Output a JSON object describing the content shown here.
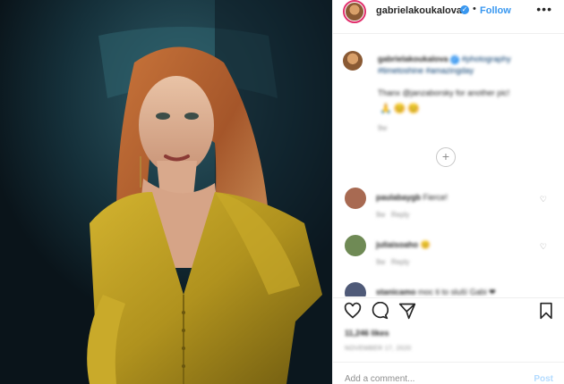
{
  "header": {
    "username": "gabrielakoukalova",
    "verified_mark": "✓",
    "separator": "•",
    "follow_label": "Follow",
    "more_label": "•••"
  },
  "caption": {
    "username": "gabrielakoukalova",
    "hashtags": "#photography #timetoshine #amazingday",
    "thanks": "Thanx @janzaborsky for another pic!",
    "emojis": "🙏😊😊",
    "age": "9w"
  },
  "load_more_label": "+",
  "comments": [
    {
      "username": "paulabaygb",
      "text": "Fierce!",
      "age": "9w",
      "reply": "Reply",
      "avatar_color": "#a86a52"
    },
    {
      "username": "juliaisoaho",
      "text": "😊",
      "age": "9w",
      "reply": "Reply",
      "avatar_color": "#6f8a55"
    },
    {
      "username": "stanicamo",
      "text": "moc ti to sluší Gabi ❤",
      "age": "",
      "reply": "",
      "avatar_color": "#4f5a78"
    }
  ],
  "actions": {
    "like_icon": "heart-outline",
    "comment_icon": "speech-bubble",
    "share_icon": "paper-plane",
    "save_icon": "bookmark"
  },
  "likes": "11,246 likes",
  "date": "NOVEMBER 17, 2020",
  "add_comment": {
    "placeholder": "Add a comment...",
    "post_label": "Post"
  },
  "colors": {
    "accent": "#3897f0",
    "post_disabled": "#b3dbff",
    "photo_background": "#0e1c24",
    "dress": "#b89a22",
    "hair": "#b0612f"
  }
}
